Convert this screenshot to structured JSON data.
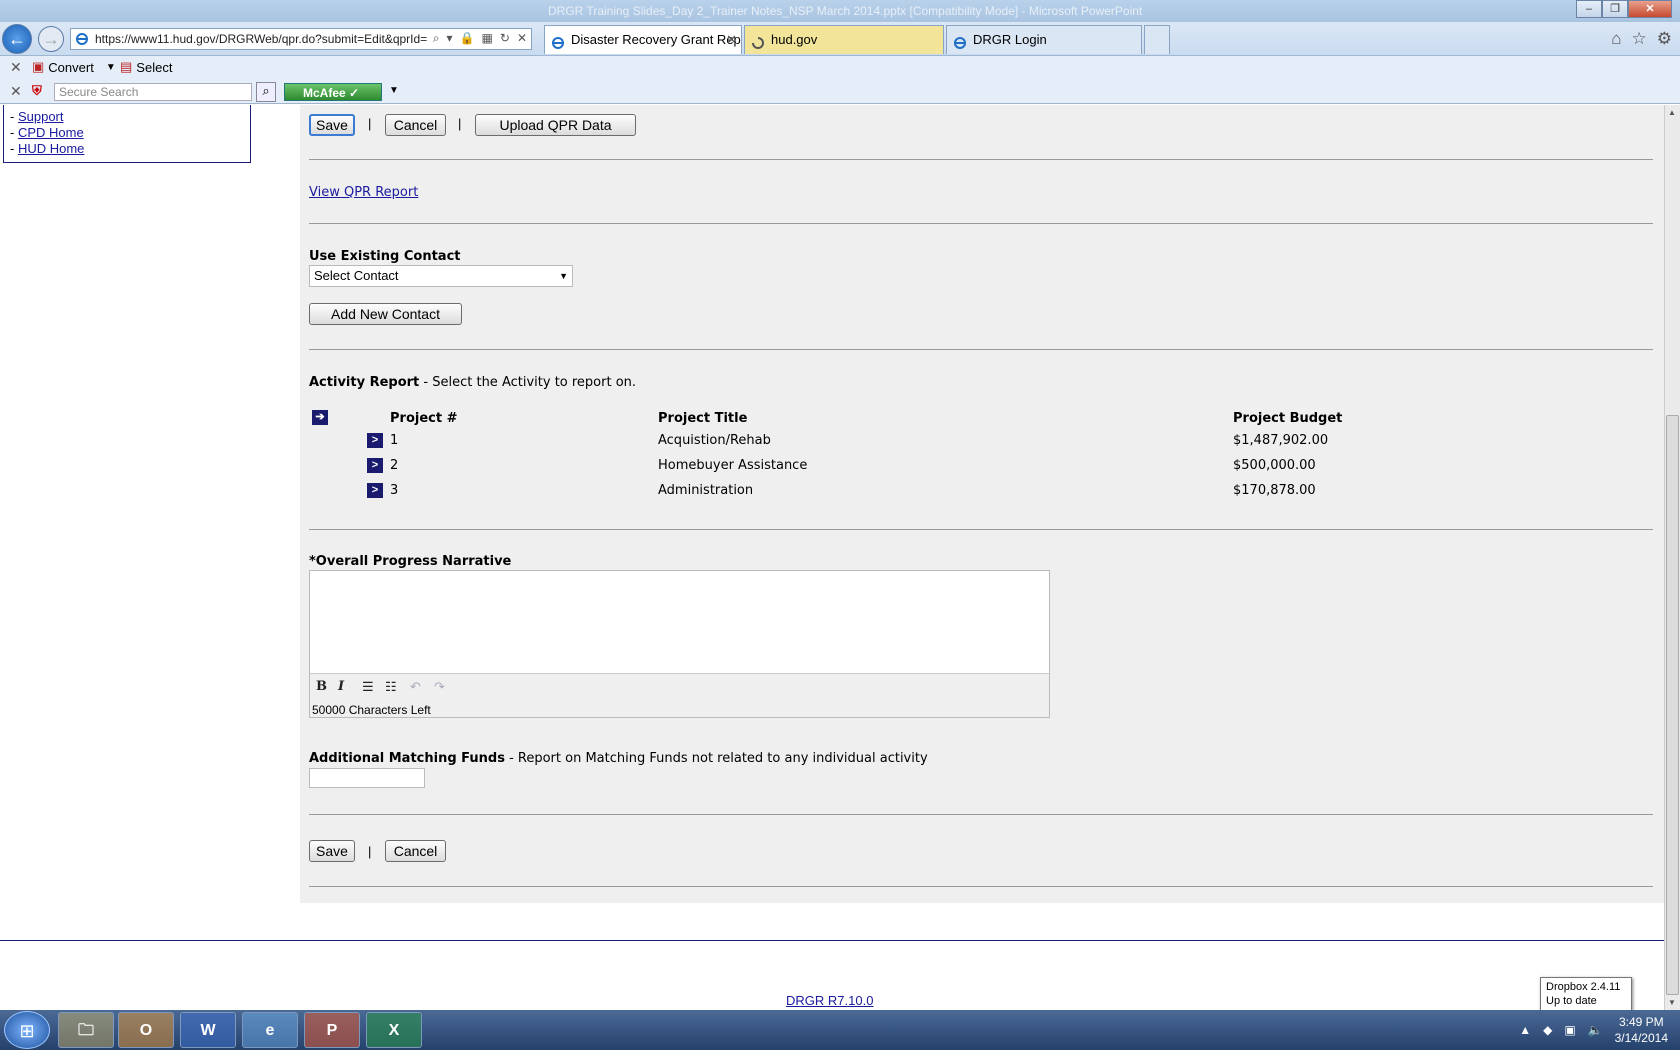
{
  "window": {
    "title": "DRGR Training Slides_Day 2_Trainer Notes_NSP March 2014.pptx [Compatibility Mode] - Microsoft PowerPoint",
    "controls": [
      "minimize",
      "restore",
      "close"
    ]
  },
  "browser": {
    "url": "https://www11.hud.gov/DRGRWeb/qpr.do?submit=Edit&qprId=",
    "tabs": [
      {
        "label": "Disaster Recovery Grant Rep...",
        "active": true
      },
      {
        "label": "hud.gov",
        "loading": true
      },
      {
        "label": "DRGR Login"
      }
    ],
    "toolbar": {
      "convert_label": "Convert",
      "select_label": "Select",
      "search_placeholder": "Secure Search",
      "mcafee_label": "McAfee"
    }
  },
  "left_nav": {
    "items": [
      {
        "label": "Support"
      },
      {
        "label": "CPD Home"
      },
      {
        "label": "HUD Home"
      }
    ]
  },
  "form": {
    "save_label": "Save",
    "cancel_label": "Cancel",
    "upload_label": "Upload QPR Data",
    "separator": "|",
    "view_report_link": "View QPR Report",
    "contact_heading": "Use Existing Contact",
    "contact_select_value": "Select Contact",
    "add_contact_label": "Add New Contact",
    "activity_heading": "Activity Report",
    "activity_sub": " - Select the Activity to report on.",
    "columns": {
      "project_num": "Project #",
      "title": "Project Title",
      "budget": "Project Budget"
    },
    "projects": [
      {
        "num": "1",
        "title": "Acquistion/Rehab",
        "budget": "$1,487,902.00"
      },
      {
        "num": "2",
        "title": "Homebuyer Assistance",
        "budget": "$500,000.00"
      },
      {
        "num": "3",
        "title": "Administration",
        "budget": "$170,878.00"
      }
    ],
    "narrative_heading": "*Overall Progress Narrative",
    "chars_left": "50000 Characters Left",
    "matching_heading": "Additional Matching Funds",
    "matching_sub": " - Report on Matching Funds not related to any individual activity"
  },
  "footer": {
    "version_link": "DRGR R7.10.0"
  },
  "tooltip": {
    "line1": "Dropbox 2.4.11",
    "line2": "Up to date"
  },
  "taskbar": {
    "apps": [
      "explorer",
      "outlook",
      "word",
      "internet-explorer",
      "powerpoint",
      "excel"
    ],
    "time": "3:49 PM",
    "date": "3/14/2014"
  }
}
